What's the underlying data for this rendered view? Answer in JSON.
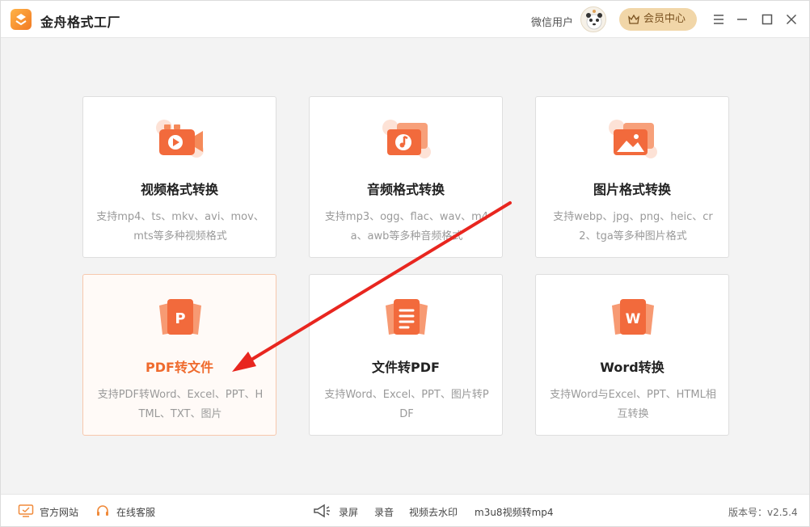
{
  "app": {
    "title": "金舟格式工厂"
  },
  "header": {
    "user_name": "微信用户",
    "vip_label": "会员中心"
  },
  "cards": [
    {
      "title": "视频格式转换",
      "desc": "支持mp4、ts、mkv、avi、mov、mts等多种视频格式",
      "icon": "video-icon"
    },
    {
      "title": "音频格式转换",
      "desc": "支持mp3、ogg、flac、wav、m4a、awb等多种音频格式",
      "icon": "audio-icon"
    },
    {
      "title": "图片格式转换",
      "desc": "支持webp、jpg、png、heic、cr2、tga等多种图片格式",
      "icon": "image-icon"
    },
    {
      "title": "PDF转文件",
      "desc": "支持PDF转Word、Excel、PPT、HTML、TXT、图片",
      "icon": "pdf-icon"
    },
    {
      "title": "文件转PDF",
      "desc": "支持Word、Excel、PPT、图片转PDF",
      "icon": "document-icon"
    },
    {
      "title": "Word转换",
      "desc": "支持Word与Excel、PPT、HTML相互转换",
      "icon": "word-icon"
    }
  ],
  "footer": {
    "official_site": "官方网站",
    "online_service": "在线客服",
    "screen_record": "录屏",
    "audio_record": "录音",
    "video_watermark": "视频去水印",
    "m3u8_convert": "m3u8视频转mp4",
    "version": "版本号：v2.5.4"
  },
  "colors": {
    "accent": "#ef6a2d",
    "vip_bg": "#f1d6a8",
    "arrow": "#e8261f"
  }
}
